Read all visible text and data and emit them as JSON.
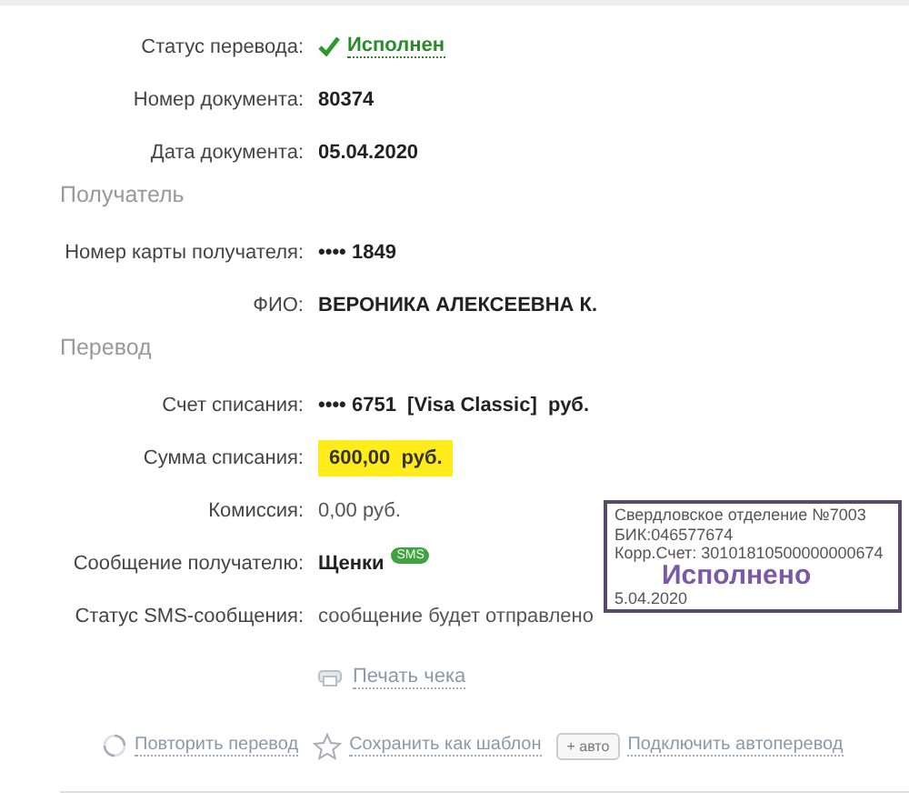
{
  "sections": [
    {
      "rows": [
        {
          "label": "Статус перевода:",
          "value": "Исполнен",
          "kind": "status"
        },
        {
          "label": "Номер документа:",
          "value": "80374",
          "kind": "bold"
        },
        {
          "label": "Дата документа:",
          "value": "05.04.2020",
          "kind": "bold"
        }
      ]
    },
    {
      "title": "Получатель",
      "rows": [
        {
          "label": "Номер карты получателя:",
          "value": "•••• 1849",
          "kind": "bold"
        },
        {
          "label": "ФИО:",
          "value": "ВЕРОНИКА АЛЕКСЕЕВНА К.",
          "kind": "bold"
        }
      ]
    },
    {
      "title": "Перевод",
      "rows": [
        {
          "label": "Счет списания:",
          "value": "•••• 6751  [Visa Classic]  руб.",
          "kind": "bold"
        },
        {
          "label": "Сумма списания:",
          "value": "600,00  руб.",
          "kind": "highlight"
        },
        {
          "label": "Комиссия:",
          "value": "0,00 руб.",
          "kind": "plain"
        },
        {
          "label": "Сообщение получателю:",
          "value": "Щенки",
          "kind": "message",
          "badge": "SMS"
        },
        {
          "label": "Статус SMS-сообщения:",
          "value": "сообщение будет отправлено",
          "kind": "plain"
        }
      ]
    }
  ],
  "print_link": "Печать чека",
  "actions": [
    {
      "kind": "repeat",
      "label": "Повторить перевод"
    },
    {
      "kind": "star",
      "label": "Сохранить как шаблон"
    },
    {
      "kind": "auto",
      "tag": "+ авто",
      "label": "Подключить автоперевод"
    }
  ],
  "stamp": {
    "lines": [
      "Свердловское отделение №7003",
      "БИК:046577674",
      "Корр.Счет: 30101810500000000674"
    ],
    "status": "Исполнено",
    "date": "5.04.2020"
  }
}
